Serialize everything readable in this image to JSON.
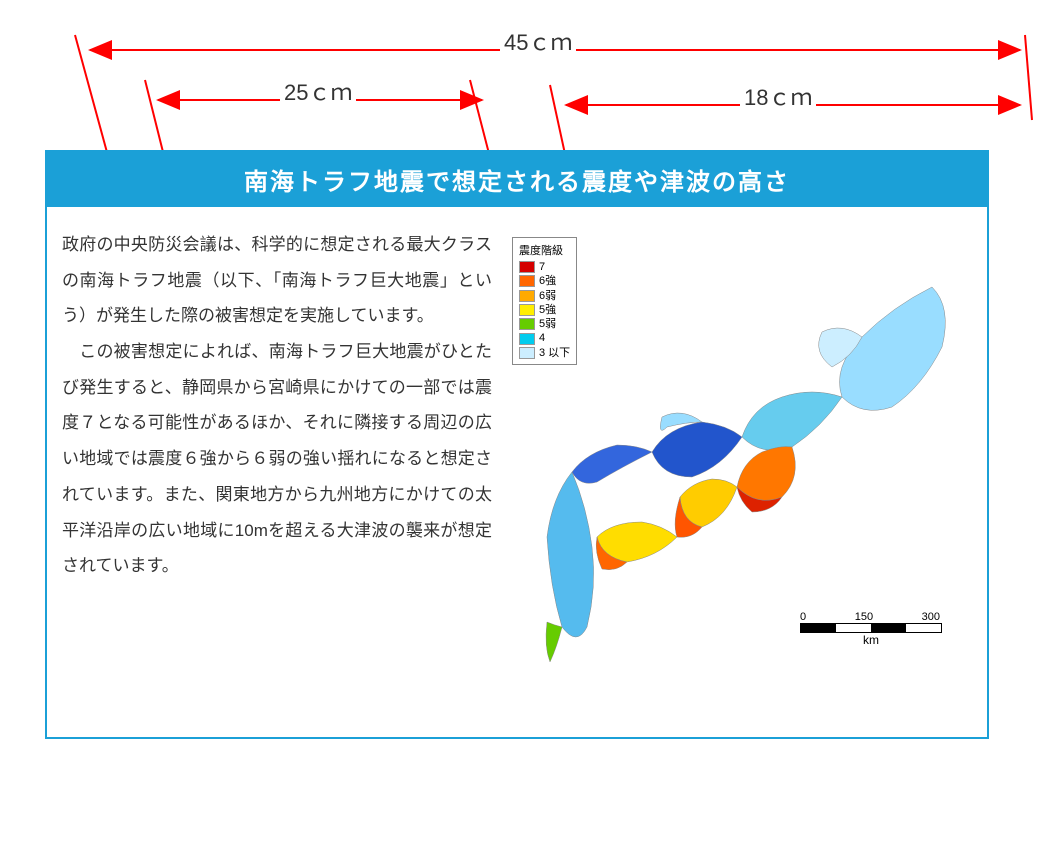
{
  "dimensions": {
    "top": "45ｃｍ",
    "left": "25ｃｍ",
    "right": "18ｃｍ"
  },
  "title": "南海トラフ地震で想定される震度や津波の高さ",
  "body": {
    "p1": "政府の中央防災会議は、科学的に想定される最大クラスの南海トラフ地震（以下、「南海トラフ巨大地震」という）が発生した際の被害想定を実施しています。",
    "p2": "　この被害想定によれば、南海トラフ巨大地震がひとたび発生すると、静岡県から宮崎県にかけての一部では震度７となる可能性があるほか、それに隣接する周辺の広い地域では震度６強から６弱の強い揺れになると想定されています。また、関東地方から九州地方にかけての太平洋沿岸の広い地域に10mを超える大津波の襲来が想定されています。"
  },
  "map": {
    "legend_title": "震度階級",
    "legend": [
      {
        "label": "7",
        "color": "#d40000"
      },
      {
        "label": "6強",
        "color": "#ff6600"
      },
      {
        "label": "6弱",
        "color": "#ffaa00"
      },
      {
        "label": "5強",
        "color": "#ffee00"
      },
      {
        "label": "5弱",
        "color": "#66cc00"
      },
      {
        "label": "4",
        "color": "#00ccee"
      },
      {
        "label": "3 以下",
        "color": "#cceeff"
      }
    ],
    "scale": {
      "ticks": [
        "0",
        "150",
        "300"
      ],
      "unit": "km"
    }
  }
}
